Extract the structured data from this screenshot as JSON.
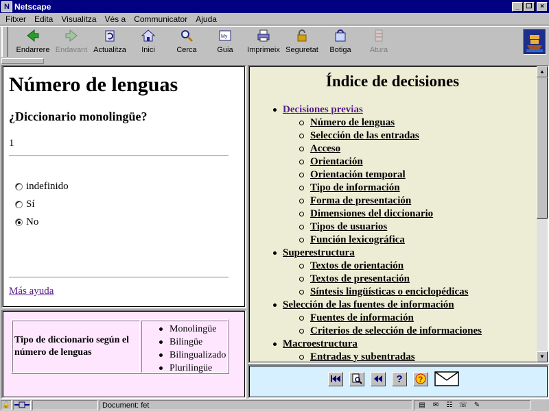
{
  "window": {
    "title": "Netscape",
    "controls": {
      "minimize": "_",
      "restore": "❐",
      "close": "×"
    }
  },
  "menu": [
    {
      "label": "Fitxer"
    },
    {
      "label": "Edita"
    },
    {
      "label": "Visualitza"
    },
    {
      "label": "Vés a"
    },
    {
      "label": "Communicator"
    },
    {
      "label": "Ajuda"
    }
  ],
  "toolbar": {
    "buttons": [
      {
        "label": "Endarrere",
        "icon": "back-icon",
        "enabled": true
      },
      {
        "label": "Endavant",
        "icon": "forward-icon",
        "enabled": false
      },
      {
        "label": "Actualitza",
        "icon": "reload-icon",
        "enabled": true
      },
      {
        "label": "Inici",
        "icon": "home-icon",
        "enabled": true
      },
      {
        "label": "Cerca",
        "icon": "search-icon",
        "enabled": true
      },
      {
        "label": "Guia",
        "icon": "guide-icon",
        "enabled": true
      },
      {
        "label": "Imprimeix",
        "icon": "print-icon",
        "enabled": true
      },
      {
        "label": "Seguretat",
        "icon": "security-icon",
        "enabled": true
      },
      {
        "label": "Botiga",
        "icon": "shop-icon",
        "enabled": true
      },
      {
        "label": "Atura",
        "icon": "stop-icon",
        "enabled": false
      }
    ]
  },
  "question_frame": {
    "heading": "Número de lenguas",
    "question": "¿Diccionario monolingüe?",
    "number": "1",
    "options": [
      {
        "label": "indefinido",
        "checked": false
      },
      {
        "label": "Sí",
        "checked": false
      },
      {
        "label": "No",
        "checked": true
      }
    ],
    "help_link": "Más ayuda"
  },
  "summary_frame": {
    "label": "Tipo de diccionario según el número de lenguas",
    "items": [
      "Monolingüe",
      "Bilingüe",
      "Bilingualizado",
      "Plurilingüe"
    ]
  },
  "index_frame": {
    "title": "Índice de decisiones",
    "items": [
      {
        "level": 1,
        "label": "Decisiones previas",
        "visited": true
      },
      {
        "level": 2,
        "label": "Número de lenguas"
      },
      {
        "level": 2,
        "label": "Selección de las entradas"
      },
      {
        "level": 2,
        "label": "Acceso"
      },
      {
        "level": 2,
        "label": "Orientación"
      },
      {
        "level": 2,
        "label": "Orientación temporal"
      },
      {
        "level": 2,
        "label": "Tipo de información"
      },
      {
        "level": 2,
        "label": "Forma de presentación"
      },
      {
        "level": 2,
        "label": "Dimensiones del diccionario"
      },
      {
        "level": 2,
        "label": "Tipos de usuarios"
      },
      {
        "level": 2,
        "label": "Función lexicográfica"
      },
      {
        "level": 1,
        "label": "Superestructura"
      },
      {
        "level": 2,
        "label": "Textos de orientación"
      },
      {
        "level": 2,
        "label": "Textos de presentación"
      },
      {
        "level": 2,
        "label": "Síntesis lingüísticas o enciclopédicas"
      },
      {
        "level": 1,
        "label": "Selección de las fuentes de información"
      },
      {
        "level": 2,
        "label": "Fuentes de información"
      },
      {
        "level": 2,
        "label": "Criterios de selección de informaciones"
      },
      {
        "level": 1,
        "label": "Macroestructura"
      },
      {
        "level": 2,
        "label": "Entradas y subentradas"
      }
    ]
  },
  "nav_frame": {
    "buttons": [
      {
        "name": "first-page-icon",
        "glyph": "⏮"
      },
      {
        "name": "search-page-icon",
        "glyph": "🔍"
      },
      {
        "name": "previous-page-icon",
        "glyph": "⏪"
      },
      {
        "name": "help-icon",
        "glyph": "?"
      },
      {
        "name": "help-question-icon",
        "glyph": "?"
      }
    ],
    "mail": {
      "name": "mail-icon",
      "glyph": "✉"
    }
  },
  "status": {
    "document": "Document: fet"
  },
  "colors": {
    "titlebar": "#000080",
    "question_bg": "#ffffff",
    "summary_bg": "#ffe6ff",
    "index_bg": "#ededd5",
    "nav_bg": "#d6f0ff",
    "visited_link": "#551a8b"
  }
}
